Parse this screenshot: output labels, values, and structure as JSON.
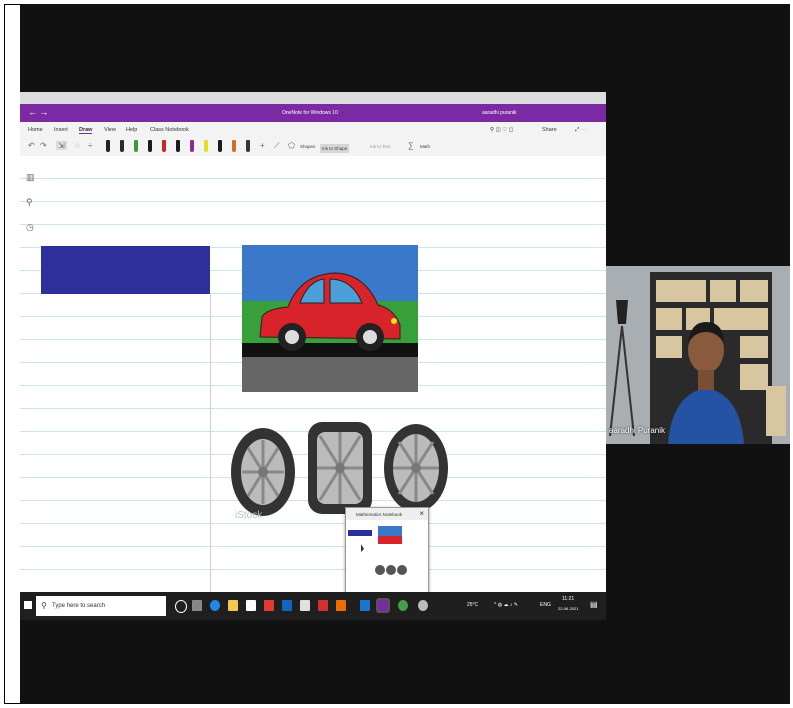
{
  "app": {
    "window_title": "OneNote for Windows 10",
    "user_name": "aaradhi puranik"
  },
  "ribbon": {
    "tabs": [
      {
        "label": "Home"
      },
      {
        "label": "Insert"
      },
      {
        "label": "Draw",
        "active": true
      },
      {
        "label": "View"
      },
      {
        "label": "Help"
      },
      {
        "label": "Class Notebook"
      }
    ],
    "right_share": "Share"
  },
  "toolbar": {
    "pen_colors": [
      "#222222",
      "#2a2a2a",
      "#3a9a3a",
      "#1a1a1a",
      "#c62828",
      "#1a1a1a",
      "#8e2a8e",
      "#e0e020",
      "#1a1a1a",
      "#d07020",
      "#333333"
    ],
    "shapes_label": "Shapes",
    "ink_to_shape_label": "Ink to Shape",
    "ink_to_text_label": "Ink to Text",
    "math_label": "Math"
  },
  "colors": {
    "title_bar": "#7b2aa3",
    "blue_rect": "#2c2f9c",
    "taskbar": "#1f1f1f"
  },
  "popup": {
    "title": "Mathematics Notebook"
  },
  "taskbar": {
    "search_placeholder": "Type here to search",
    "weather": "25°C",
    "language": "ENG",
    "time": "11:21",
    "date": "22-06-2021"
  },
  "canvas": {
    "watermark": "iStock"
  },
  "webcam": {
    "participant_name": "aaradhi Puranik"
  }
}
